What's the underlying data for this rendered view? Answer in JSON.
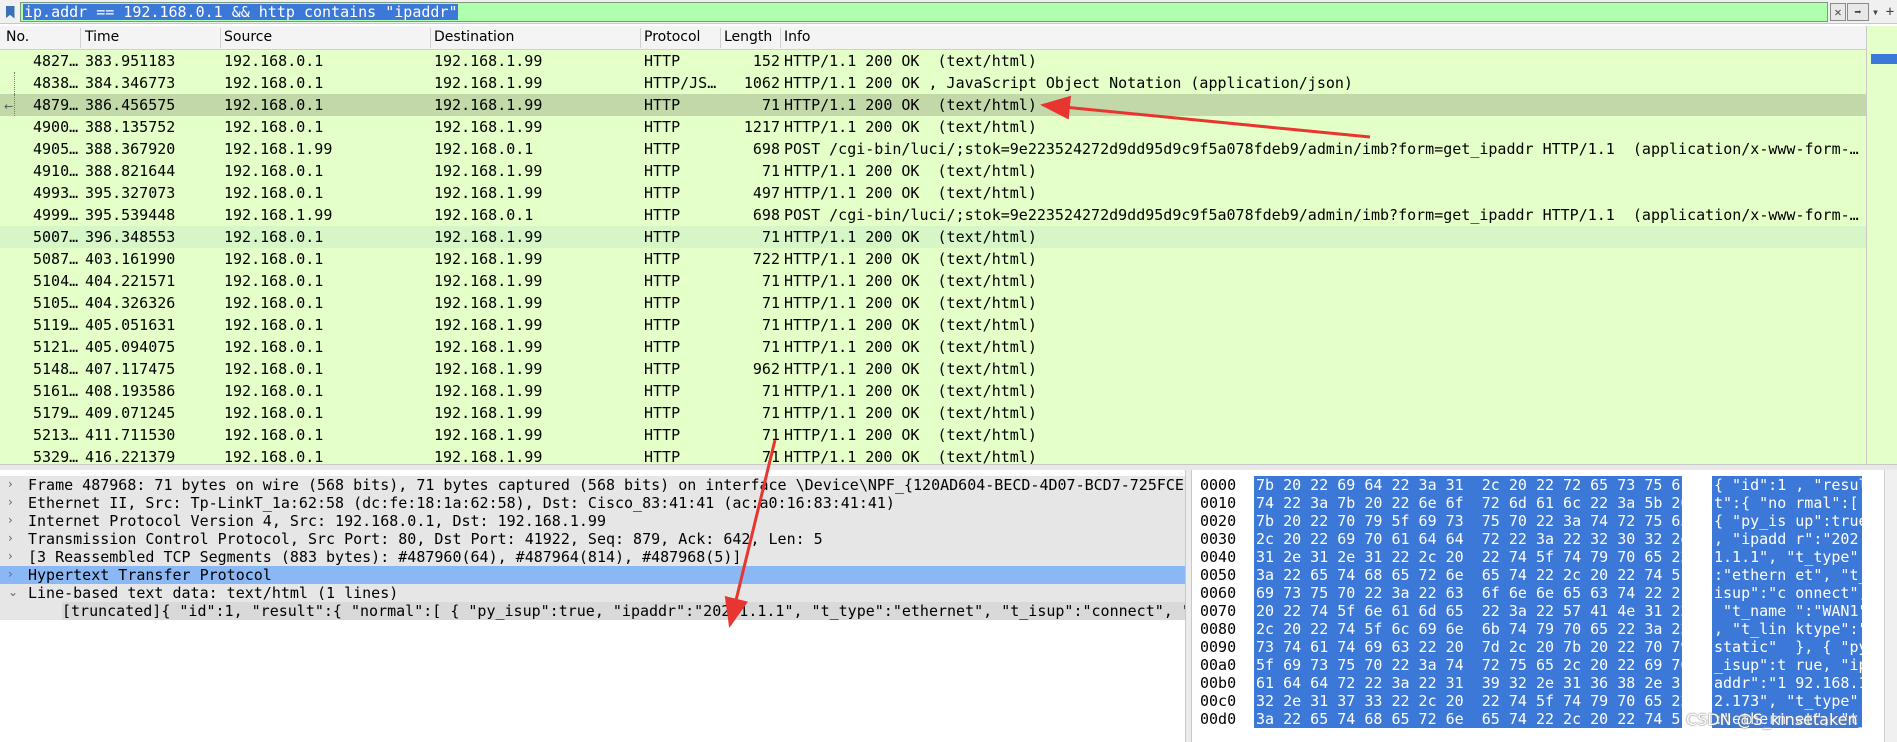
{
  "filter": {
    "expression": "ip.addr == 192.168.0.1 && http contains \"ipaddr\"",
    "clear_glyph": "✕",
    "apply_glyph": "➡",
    "dropdown_glyph": "▾",
    "add_glyph": "+"
  },
  "packet_list": {
    "columns": [
      "No.",
      "Time",
      "Source",
      "Destination",
      "Protocol",
      "Length",
      "Info"
    ],
    "rows": [
      {
        "no": "4827…",
        "time": "383.951183",
        "src": "192.168.0.1",
        "dst": "192.168.1.99",
        "proto": "HTTP",
        "len": "152",
        "info": "HTTP/1.1 200 OK  (text/html)"
      },
      {
        "no": "4838…",
        "time": "384.346773",
        "src": "192.168.0.1",
        "dst": "192.168.1.99",
        "proto": "HTTP/JS…",
        "len": "1062",
        "info": "HTTP/1.1 200 OK , JavaScript Object Notation (application/json)"
      },
      {
        "no": "4879…",
        "time": "386.456575",
        "src": "192.168.0.1",
        "dst": "192.168.1.99",
        "proto": "HTTP",
        "len": "71",
        "info": "HTTP/1.1 200 OK  (text/html)"
      },
      {
        "no": "4900…",
        "time": "388.135752",
        "src": "192.168.0.1",
        "dst": "192.168.1.99",
        "proto": "HTTP",
        "len": "1217",
        "info": "HTTP/1.1 200 OK  (text/html)"
      },
      {
        "no": "4905…",
        "time": "388.367920",
        "src": "192.168.1.99",
        "dst": "192.168.0.1",
        "proto": "HTTP",
        "len": "698",
        "info": "POST /cgi-bin/luci/;stok=9e223524272d9dd95d9c9f5a078fdeb9/admin/imb?form=get_ipaddr HTTP/1.1  (application/x-www-form-…"
      },
      {
        "no": "4910…",
        "time": "388.821644",
        "src": "192.168.0.1",
        "dst": "192.168.1.99",
        "proto": "HTTP",
        "len": "71",
        "info": "HTTP/1.1 200 OK  (text/html)"
      },
      {
        "no": "4993…",
        "time": "395.327073",
        "src": "192.168.0.1",
        "dst": "192.168.1.99",
        "proto": "HTTP",
        "len": "497",
        "info": "HTTP/1.1 200 OK  (text/html)"
      },
      {
        "no": "4999…",
        "time": "395.539448",
        "src": "192.168.1.99",
        "dst": "192.168.0.1",
        "proto": "HTTP",
        "len": "698",
        "info": "POST /cgi-bin/luci/;stok=9e223524272d9dd95d9c9f5a078fdeb9/admin/imb?form=get_ipaddr HTTP/1.1  (application/x-www-form-…"
      },
      {
        "no": "5007…",
        "time": "396.348553",
        "src": "192.168.0.1",
        "dst": "192.168.1.99",
        "proto": "HTTP",
        "len": "71",
        "info": "HTTP/1.1 200 OK  (text/html)"
      },
      {
        "no": "5087…",
        "time": "403.161990",
        "src": "192.168.0.1",
        "dst": "192.168.1.99",
        "proto": "HTTP",
        "len": "722",
        "info": "HTTP/1.1 200 OK  (text/html)"
      },
      {
        "no": "5104…",
        "time": "404.221571",
        "src": "192.168.0.1",
        "dst": "192.168.1.99",
        "proto": "HTTP",
        "len": "71",
        "info": "HTTP/1.1 200 OK  (text/html)"
      },
      {
        "no": "5105…",
        "time": "404.326326",
        "src": "192.168.0.1",
        "dst": "192.168.1.99",
        "proto": "HTTP",
        "len": "71",
        "info": "HTTP/1.1 200 OK  (text/html)"
      },
      {
        "no": "5119…",
        "time": "405.051631",
        "src": "192.168.0.1",
        "dst": "192.168.1.99",
        "proto": "HTTP",
        "len": "71",
        "info": "HTTP/1.1 200 OK  (text/html)"
      },
      {
        "no": "5121…",
        "time": "405.094075",
        "src": "192.168.0.1",
        "dst": "192.168.1.99",
        "proto": "HTTP",
        "len": "71",
        "info": "HTTP/1.1 200 OK  (text/html)"
      },
      {
        "no": "5148…",
        "time": "407.117475",
        "src": "192.168.0.1",
        "dst": "192.168.1.99",
        "proto": "HTTP",
        "len": "962",
        "info": "HTTP/1.1 200 OK  (text/html)"
      },
      {
        "no": "5161…",
        "time": "408.193586",
        "src": "192.168.0.1",
        "dst": "192.168.1.99",
        "proto": "HTTP",
        "len": "71",
        "info": "HTTP/1.1 200 OK  (text/html)"
      },
      {
        "no": "5179…",
        "time": "409.071245",
        "src": "192.168.0.1",
        "dst": "192.168.1.99",
        "proto": "HTTP",
        "len": "71",
        "info": "HTTP/1.1 200 OK  (text/html)"
      },
      {
        "no": "5213…",
        "time": "411.711530",
        "src": "192.168.0.1",
        "dst": "192.168.1.99",
        "proto": "HTTP",
        "len": "71",
        "info": "HTTP/1.1 200 OK  (text/html)"
      },
      {
        "no": "5329…",
        "time": "416.221379",
        "src": "192.168.0.1",
        "dst": "192.168.1.99",
        "proto": "HTTP",
        "len": "71",
        "info": "HTTP/1.1 200 OK  (text/html)"
      }
    ],
    "selected_index": 2,
    "highlight_index": 8
  },
  "details": {
    "collapsed_glyph": "›",
    "expanded_glyph": "⌄",
    "items": [
      {
        "text": "Frame 487968: 71 bytes on wire (568 bits), 71 bytes captured (568 bits) on interface \\Device\\NPF_{120AD604-BECD-4D07-BCD7-725FCE",
        "state": "collapsed"
      },
      {
        "text": "Ethernet II, Src: Tp-LinkT_1a:62:58 (dc:fe:18:1a:62:58), Dst: Cisco_83:41:41 (ac:a0:16:83:41:41)",
        "state": "collapsed"
      },
      {
        "text": "Internet Protocol Version 4, Src: 192.168.0.1, Dst: 192.168.1.99",
        "state": "collapsed"
      },
      {
        "text": "Transmission Control Protocol, Src Port: 80, Dst Port: 41922, Seq: 879, Ack: 642, Len: 5",
        "state": "collapsed"
      },
      {
        "text": "[3 Reassembled TCP Segments (883 bytes): #487960(64), #487964(814), #487968(5)]",
        "state": "collapsed"
      },
      {
        "text": "Hypertext Transfer Protocol",
        "state": "collapsed"
      },
      {
        "text": "Line-based text data: text/html (1 lines)",
        "state": "expanded"
      },
      {
        "text": "[truncated]{ \"id\":1, \"result\":{ \"normal\":[ { \"py_isup\":true, \"ipaddr\":\"202.1.1.1\", \"t_type\":\"ethernet\", \"t_isup\":\"connect\", \"",
        "state": "child"
      }
    ],
    "selected_index": 5
  },
  "bytes": {
    "rows": [
      {
        "off": "0000",
        "hex": "7b 20 22 69 64 22 3a 31  2c 20 22 72 65 73 75 6c",
        "ascii": "{ \"id\":1 , \"resul"
      },
      {
        "off": "0010",
        "hex": "74 22 3a 7b 20 22 6e 6f  72 6d 61 6c 22 3a 5b 20",
        "ascii": "t\":{ \"no rmal\":[ "
      },
      {
        "off": "0020",
        "hex": "7b 20 22 70 79 5f 69 73  75 70 22 3a 74 72 75 65",
        "ascii": "{ \"py_is up\":true"
      },
      {
        "off": "0030",
        "hex": "2c 20 22 69 70 61 64 64  72 22 3a 22 32 30 32 2e",
        "ascii": ", \"ipadd r\":\"202."
      },
      {
        "off": "0040",
        "hex": "31 2e 31 2e 31 22 2c 20  22 74 5f 74 79 70 65 22",
        "ascii": "1.1.1\", \"t_type\""
      },
      {
        "off": "0050",
        "hex": "3a 22 65 74 68 65 72 6e  65 74 22 2c 20 22 74 5f",
        "ascii": ":\"ethern et\", \"t_"
      },
      {
        "off": "0060",
        "hex": "69 73 75 70 22 3a 22 63  6f 6e 6e 65 63 74 22 2c",
        "ascii": "isup\":\"c onnect\","
      },
      {
        "off": "0070",
        "hex": "20 22 74 5f 6e 61 6d 65  22 3a 22 57 41 4e 31 22",
        "ascii": " \"t_name \":\"WAN1\""
      },
      {
        "off": "0080",
        "hex": "2c 20 22 74 5f 6c 69 6e  6b 74 79 70 65 22 3a 22",
        "ascii": ", \"t_lin ktype\":\""
      },
      {
        "off": "0090",
        "hex": "73 74 61 74 69 63 22 20  7d 2c 20 7b 20 22 70 79",
        "ascii": "static\"  }, { \"py"
      },
      {
        "off": "00a0",
        "hex": "5f 69 73 75 70 22 3a 74  72 75 65 2c 20 22 69 70",
        "ascii": "_isup\":t rue, \"ip"
      },
      {
        "off": "00b0",
        "hex": "61 64 64 72 22 3a 22 31  39 32 2e 31 36 38 2e 31",
        "ascii": "addr\":\"1 92.168.1"
      },
      {
        "off": "00c0",
        "hex": "32 2e 31 37 33 22 2c 20  22 74 5f 74 79 70 65 22",
        "ascii": "2.173\", \"t_type\""
      },
      {
        "off": "00d0",
        "hex": "3a 22 65 74 68 65 72 6e  65 74 22 2c 20 22 74 5f",
        "ascii": ":\"ethern et\", \"t_"
      }
    ]
  },
  "watermark": "CSDN @S_kinsetaken",
  "colors": {
    "filter_ok": "#afffaf",
    "row_green": "#e4ffc7",
    "row_selected": "#c2d8a8",
    "selection_blue": "#3c78d8",
    "tree_selected": "#8ab8f5",
    "annotation_red": "#e8352f"
  }
}
